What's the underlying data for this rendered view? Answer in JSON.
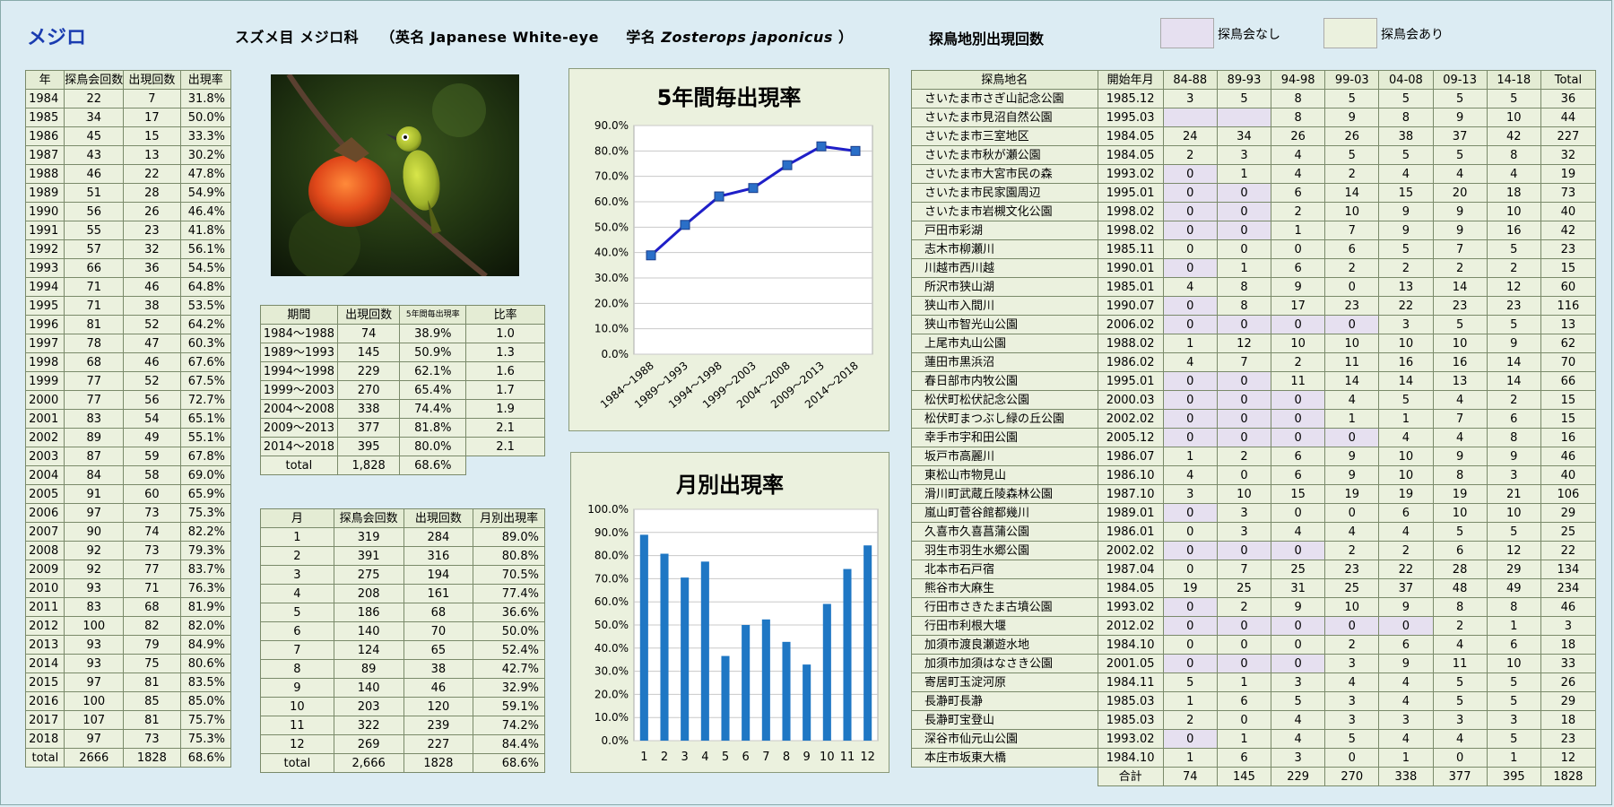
{
  "header": {
    "title": "メジロ",
    "taxon": "スズメ目 メジロ科",
    "english_name": "（英名 Japanese White-eye",
    "sci_prefix": "学名",
    "sci_name": "Zosterops japonicus",
    "sci_suffix": "）",
    "section_title": "探鳥地別出現回数",
    "legend_none": "探鳥会なし",
    "legend_yes": "探鳥会あり"
  },
  "colors": {
    "legend_none": "#e6e0f0",
    "legend_yes": "#ebf1de",
    "line": "#1f1fc8",
    "bar": "#1f77c4",
    "cell": "#ebf1de"
  },
  "photo": {
    "alt": "persimmon-and-white-eye-photo"
  },
  "year_table": {
    "headers": [
      "年",
      "探鳥会回数",
      "出現回数",
      "出現率"
    ],
    "rows": [
      [
        "1984",
        "22",
        "7",
        "31.8%"
      ],
      [
        "1985",
        "34",
        "17",
        "50.0%"
      ],
      [
        "1986",
        "45",
        "15",
        "33.3%"
      ],
      [
        "1987",
        "43",
        "13",
        "30.2%"
      ],
      [
        "1988",
        "46",
        "22",
        "47.8%"
      ],
      [
        "1989",
        "51",
        "28",
        "54.9%"
      ],
      [
        "1990",
        "56",
        "26",
        "46.4%"
      ],
      [
        "1991",
        "55",
        "23",
        "41.8%"
      ],
      [
        "1992",
        "57",
        "32",
        "56.1%"
      ],
      [
        "1993",
        "66",
        "36",
        "54.5%"
      ],
      [
        "1994",
        "71",
        "46",
        "64.8%"
      ],
      [
        "1995",
        "71",
        "38",
        "53.5%"
      ],
      [
        "1996",
        "81",
        "52",
        "64.2%"
      ],
      [
        "1997",
        "78",
        "47",
        "60.3%"
      ],
      [
        "1998",
        "68",
        "46",
        "67.6%"
      ],
      [
        "1999",
        "77",
        "52",
        "67.5%"
      ],
      [
        "2000",
        "77",
        "56",
        "72.7%"
      ],
      [
        "2001",
        "83",
        "54",
        "65.1%"
      ],
      [
        "2002",
        "89",
        "49",
        "55.1%"
      ],
      [
        "2003",
        "87",
        "59",
        "67.8%"
      ],
      [
        "2004",
        "84",
        "58",
        "69.0%"
      ],
      [
        "2005",
        "91",
        "60",
        "65.9%"
      ],
      [
        "2006",
        "97",
        "73",
        "75.3%"
      ],
      [
        "2007",
        "90",
        "74",
        "82.2%"
      ],
      [
        "2008",
        "92",
        "73",
        "79.3%"
      ],
      [
        "2009",
        "92",
        "77",
        "83.7%"
      ],
      [
        "2010",
        "93",
        "71",
        "76.3%"
      ],
      [
        "2011",
        "83",
        "68",
        "81.9%"
      ],
      [
        "2012",
        "100",
        "82",
        "82.0%"
      ],
      [
        "2013",
        "93",
        "79",
        "84.9%"
      ],
      [
        "2014",
        "93",
        "75",
        "80.6%"
      ],
      [
        "2015",
        "97",
        "81",
        "83.5%"
      ],
      [
        "2016",
        "100",
        "85",
        "85.0%"
      ],
      [
        "2017",
        "107",
        "81",
        "75.7%"
      ],
      [
        "2018",
        "97",
        "73",
        "75.3%"
      ],
      [
        "total",
        "2666",
        "1828",
        "68.6%"
      ]
    ]
  },
  "period_table": {
    "headers": [
      "期間",
      "出現回数",
      "5年間毎出現率",
      "比率"
    ],
    "rows": [
      [
        "1984～1988",
        "74",
        "38.9%",
        "1.0"
      ],
      [
        "1989～1993",
        "145",
        "50.9%",
        "1.3"
      ],
      [
        "1994～1998",
        "229",
        "62.1%",
        "1.6"
      ],
      [
        "1999～2003",
        "270",
        "65.4%",
        "1.7"
      ],
      [
        "2004～2008",
        "338",
        "74.4%",
        "1.9"
      ],
      [
        "2009～2013",
        "377",
        "81.8%",
        "2.1"
      ],
      [
        "2014～2018",
        "395",
        "80.0%",
        "2.1"
      ]
    ],
    "total": [
      "total",
      "1,828",
      "68.6%"
    ]
  },
  "month_table": {
    "headers": [
      "月",
      "探鳥会回数",
      "出現回数",
      "月別出現率"
    ],
    "rows": [
      [
        "1",
        "319",
        "284",
        "89.0%"
      ],
      [
        "2",
        "391",
        "316",
        "80.8%"
      ],
      [
        "3",
        "275",
        "194",
        "70.5%"
      ],
      [
        "4",
        "208",
        "161",
        "77.4%"
      ],
      [
        "5",
        "186",
        "68",
        "36.6%"
      ],
      [
        "6",
        "140",
        "70",
        "50.0%"
      ],
      [
        "7",
        "124",
        "65",
        "52.4%"
      ],
      [
        "8",
        "89",
        "38",
        "42.7%"
      ],
      [
        "9",
        "140",
        "46",
        "32.9%"
      ],
      [
        "10",
        "203",
        "120",
        "59.1%"
      ],
      [
        "11",
        "322",
        "239",
        "74.2%"
      ],
      [
        "12",
        "269",
        "227",
        "84.4%"
      ],
      [
        "total",
        "2,666",
        "1828",
        "68.6%"
      ]
    ]
  },
  "site_table": {
    "headers": [
      "探鳥地名",
      "開始年月",
      "84-88",
      "89-93",
      "94-98",
      "99-03",
      "04-08",
      "09-13",
      "14-18",
      "Total"
    ],
    "rows": [
      {
        "name": "さいたま市さぎ山記念公園",
        "start": "1985.12",
        "v": [
          "3",
          "5",
          "8",
          "5",
          "5",
          "5",
          "5",
          "36"
        ],
        "lav": []
      },
      {
        "name": "さいたま市見沼自然公園",
        "start": "1995.03",
        "v": [
          "",
          "",
          "8",
          "9",
          "8",
          "9",
          "10",
          "44"
        ],
        "lav": [
          0,
          1
        ]
      },
      {
        "name": "さいたま市三室地区",
        "start": "1984.05",
        "v": [
          "24",
          "34",
          "26",
          "26",
          "38",
          "37",
          "42",
          "227"
        ],
        "lav": []
      },
      {
        "name": "さいたま市秋が瀬公園",
        "start": "1984.05",
        "v": [
          "2",
          "3",
          "4",
          "5",
          "5",
          "5",
          "8",
          "32"
        ],
        "lav": []
      },
      {
        "name": "さいたま市大宮市民の森",
        "start": "1993.02",
        "v": [
          "0",
          "1",
          "4",
          "2",
          "4",
          "4",
          "4",
          "19"
        ],
        "lav": [
          0
        ]
      },
      {
        "name": "さいたま市民家園周辺",
        "start": "1995.01",
        "v": [
          "0",
          "0",
          "6",
          "14",
          "15",
          "20",
          "18",
          "73"
        ],
        "lav": [
          0,
          1
        ]
      },
      {
        "name": "さいたま市岩槻文化公園",
        "start": "1998.02",
        "v": [
          "0",
          "0",
          "2",
          "10",
          "9",
          "9",
          "10",
          "40"
        ],
        "lav": [
          0,
          1
        ]
      },
      {
        "name": "戸田市彩湖",
        "start": "1998.02",
        "v": [
          "0",
          "0",
          "1",
          "7",
          "9",
          "9",
          "16",
          "42"
        ],
        "lav": [
          0,
          1
        ]
      },
      {
        "name": "志木市柳瀬川",
        "start": "1985.11",
        "v": [
          "0",
          "0",
          "0",
          "6",
          "5",
          "7",
          "5",
          "23"
        ],
        "lav": []
      },
      {
        "name": "川越市西川越",
        "start": "1990.01",
        "v": [
          "0",
          "1",
          "6",
          "2",
          "2",
          "2",
          "2",
          "15"
        ],
        "lav": [
          0
        ]
      },
      {
        "name": "所沢市狭山湖",
        "start": "1985.01",
        "v": [
          "4",
          "8",
          "9",
          "0",
          "13",
          "14",
          "12",
          "60"
        ],
        "lav": []
      },
      {
        "name": "狭山市入間川",
        "start": "1990.07",
        "v": [
          "0",
          "8",
          "17",
          "23",
          "22",
          "23",
          "23",
          "116"
        ],
        "lav": [
          0
        ]
      },
      {
        "name": "狭山市智光山公園",
        "start": "2006.02",
        "v": [
          "0",
          "0",
          "0",
          "0",
          "3",
          "5",
          "5",
          "13"
        ],
        "lav": [
          0,
          1,
          2,
          3
        ]
      },
      {
        "name": "上尾市丸山公園",
        "start": "1988.02",
        "v": [
          "1",
          "12",
          "10",
          "10",
          "10",
          "10",
          "9",
          "62"
        ],
        "lav": []
      },
      {
        "name": "蓮田市黒浜沼",
        "start": "1986.02",
        "v": [
          "4",
          "7",
          "2",
          "11",
          "16",
          "16",
          "14",
          "70"
        ],
        "lav": []
      },
      {
        "name": "春日部市内牧公園",
        "start": "1995.01",
        "v": [
          "0",
          "0",
          "11",
          "14",
          "14",
          "13",
          "14",
          "66"
        ],
        "lav": [
          0,
          1
        ]
      },
      {
        "name": "松伏町松伏記念公園",
        "start": "2000.03",
        "v": [
          "0",
          "0",
          "0",
          "4",
          "5",
          "4",
          "2",
          "15"
        ],
        "lav": [
          0,
          1,
          2
        ]
      },
      {
        "name": "松伏町まつぶし緑の丘公園",
        "start": "2002.02",
        "v": [
          "0",
          "0",
          "0",
          "1",
          "1",
          "7",
          "6",
          "15"
        ],
        "lav": [
          0,
          1,
          2
        ]
      },
      {
        "name": "幸手市宇和田公園",
        "start": "2005.12",
        "v": [
          "0",
          "0",
          "0",
          "0",
          "4",
          "4",
          "8",
          "16"
        ],
        "lav": [
          0,
          1,
          2,
          3
        ]
      },
      {
        "name": "坂戸市高麗川",
        "start": "1986.07",
        "v": [
          "1",
          "2",
          "6",
          "9",
          "10",
          "9",
          "9",
          "46"
        ],
        "lav": []
      },
      {
        "name": "東松山市物見山",
        "start": "1986.10",
        "v": [
          "4",
          "0",
          "6",
          "9",
          "10",
          "8",
          "3",
          "40"
        ],
        "lav": []
      },
      {
        "name": "滑川町武蔵丘陵森林公園",
        "start": "1987.10",
        "v": [
          "3",
          "10",
          "15",
          "19",
          "19",
          "19",
          "21",
          "106"
        ],
        "lav": []
      },
      {
        "name": "嵐山町菅谷館都幾川",
        "start": "1989.01",
        "v": [
          "0",
          "3",
          "0",
          "0",
          "6",
          "10",
          "10",
          "29"
        ],
        "lav": [
          0
        ]
      },
      {
        "name": "久喜市久喜菖蒲公園",
        "start": "1986.01",
        "v": [
          "0",
          "3",
          "4",
          "4",
          "4",
          "5",
          "5",
          "25"
        ],
        "lav": []
      },
      {
        "name": "羽生市羽生水郷公園",
        "start": "2002.02",
        "v": [
          "0",
          "0",
          "0",
          "2",
          "2",
          "6",
          "12",
          "22"
        ],
        "lav": [
          0,
          1,
          2
        ]
      },
      {
        "name": "北本市石戸宿",
        "start": "1987.04",
        "v": [
          "0",
          "7",
          "25",
          "23",
          "22",
          "28",
          "29",
          "134"
        ],
        "lav": []
      },
      {
        "name": "熊谷市大麻生",
        "start": "1984.05",
        "v": [
          "19",
          "25",
          "31",
          "25",
          "37",
          "48",
          "49",
          "234"
        ],
        "lav": []
      },
      {
        "name": "行田市さきたま古墳公園",
        "start": "1993.02",
        "v": [
          "0",
          "2",
          "9",
          "10",
          "9",
          "8",
          "8",
          "46"
        ],
        "lav": [
          0
        ]
      },
      {
        "name": "行田市利根大堰",
        "start": "2012.02",
        "v": [
          "0",
          "0",
          "0",
          "0",
          "0",
          "2",
          "1",
          "3"
        ],
        "lav": [
          0,
          1,
          2,
          3,
          4
        ]
      },
      {
        "name": "加須市渡良瀬遊水地",
        "start": "1984.10",
        "v": [
          "0",
          "0",
          "0",
          "2",
          "6",
          "4",
          "6",
          "18"
        ],
        "lav": []
      },
      {
        "name": "加須市加須はなさき公園",
        "start": "2001.05",
        "v": [
          "0",
          "0",
          "0",
          "3",
          "9",
          "11",
          "10",
          "33"
        ],
        "lav": [
          0,
          1,
          2
        ]
      },
      {
        "name": "寄居町玉淀河原",
        "start": "1984.11",
        "v": [
          "5",
          "1",
          "3",
          "4",
          "4",
          "5",
          "5",
          "26"
        ],
        "lav": []
      },
      {
        "name": "長瀞町長瀞",
        "start": "1985.03",
        "v": [
          "1",
          "6",
          "5",
          "3",
          "4",
          "5",
          "5",
          "29"
        ],
        "lav": []
      },
      {
        "name": "長瀞町宝登山",
        "start": "1985.03",
        "v": [
          "2",
          "0",
          "4",
          "3",
          "3",
          "3",
          "3",
          "18"
        ],
        "lav": []
      },
      {
        "name": "深谷市仙元山公園",
        "start": "1993.02",
        "v": [
          "0",
          "1",
          "4",
          "5",
          "4",
          "4",
          "5",
          "23"
        ],
        "lav": [
          0
        ]
      },
      {
        "name": "本庄市坂東大橋",
        "start": "1984.10",
        "v": [
          "1",
          "6",
          "3",
          "0",
          "1",
          "0",
          "1",
          "12"
        ],
        "lav": []
      }
    ],
    "footer_label": "合計",
    "footer": [
      "74",
      "145",
      "229",
      "270",
      "338",
      "377",
      "395",
      "1828"
    ]
  },
  "chart_data": [
    {
      "type": "line",
      "title": "5年間毎出現率",
      "categories": [
        "1984～1988",
        "1989～1993",
        "1994～1998",
        "1999～2003",
        "2004～2008",
        "2009～2013",
        "2014～2018"
      ],
      "values": [
        38.9,
        50.9,
        62.1,
        65.4,
        74.4,
        81.8,
        80.0
      ],
      "yticks": [
        "0.0%",
        "10.0%",
        "20.0%",
        "30.0%",
        "40.0%",
        "50.0%",
        "60.0%",
        "70.0%",
        "80.0%",
        "90.0%"
      ],
      "ylim": [
        0,
        90
      ],
      "grid": true,
      "xlabel": "",
      "ylabel": ""
    },
    {
      "type": "bar",
      "title": "月別出現率",
      "categories": [
        "1",
        "2",
        "3",
        "4",
        "5",
        "6",
        "7",
        "8",
        "9",
        "10",
        "11",
        "12"
      ],
      "values": [
        89.0,
        80.8,
        70.5,
        77.4,
        36.6,
        50.0,
        52.4,
        42.7,
        32.9,
        59.1,
        74.2,
        84.4
      ],
      "yticks": [
        "0.0%",
        "10.0%",
        "20.0%",
        "30.0%",
        "40.0%",
        "50.0%",
        "60.0%",
        "70.0%",
        "80.0%",
        "90.0%",
        "100.0%"
      ],
      "ylim": [
        0,
        100
      ],
      "grid": true,
      "xlabel": "",
      "ylabel": ""
    }
  ]
}
